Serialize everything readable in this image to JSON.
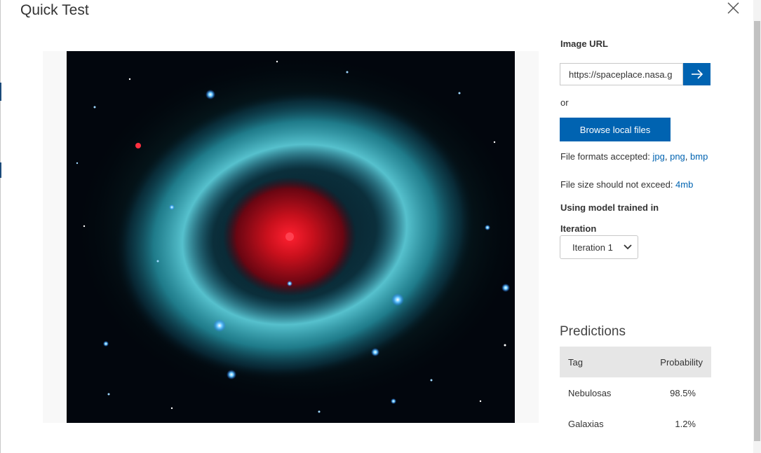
{
  "dialog": {
    "title": "Quick Test",
    "close_icon": "close-icon"
  },
  "image_url": {
    "label": "Image URL",
    "value": "https://spaceplace.nasa.g",
    "placeholder": "",
    "submit_icon": "arrow-right-icon"
  },
  "or_label": "or",
  "browse": {
    "label": "Browse local files"
  },
  "file_info": {
    "formats_prefix": "File formats accepted: ",
    "formats": [
      "jpg",
      "png",
      "bmp"
    ],
    "size_prefix": "File size should not exceed: ",
    "size_value": "4mb"
  },
  "model": {
    "heading": "Using model trained in",
    "iteration_label": "Iteration",
    "iteration_selected": "Iteration 1",
    "dropdown_icon": "chevron-down-icon"
  },
  "predictions": {
    "title": "Predictions",
    "columns": [
      "Tag",
      "Probability"
    ],
    "rows": [
      {
        "tag": "Nebulosas",
        "probability": "98.5%"
      },
      {
        "tag": "Galaxias",
        "probability": "1.2%"
      }
    ]
  },
  "colors": {
    "accent": "#0063b1",
    "header_bg": "#e6e6e6",
    "image_frame_bg": "#f8f8f8"
  }
}
